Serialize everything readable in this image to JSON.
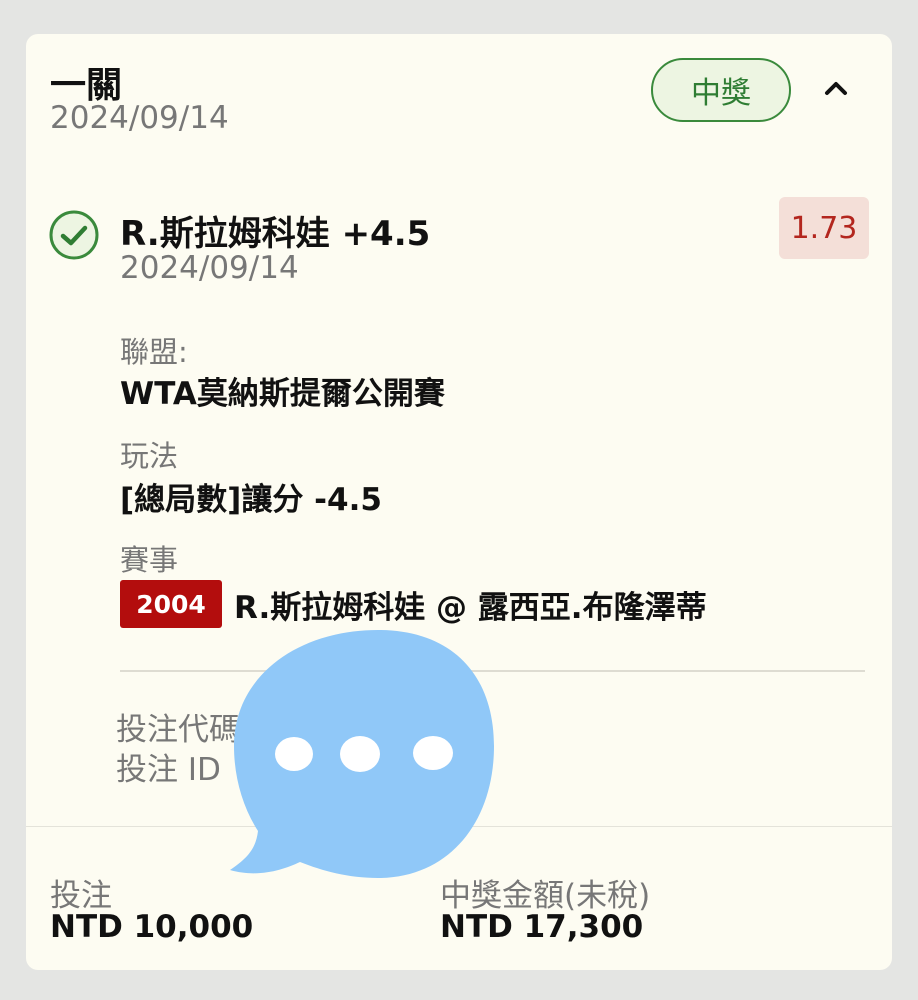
{
  "header": {
    "bet_type": "一關",
    "date": "2024/09/14",
    "status": "中獎"
  },
  "selection": {
    "name": "R.斯拉姆科娃 +4.5",
    "date": "2024/09/14",
    "odds": "1.73",
    "league_label": "聯盟:",
    "league_value": "WTA莫納斯提爾公開賽",
    "market_label": "玩法",
    "market_value": "[總局數]讓分 -4.5",
    "event_label": "賽事",
    "event_code": "2004",
    "event_name": "R.斯拉姆科娃 @ 露西亞.布隆澤蒂"
  },
  "refs": {
    "code_label": "投注代碼",
    "id_label": "投注 ID"
  },
  "footer": {
    "stake_label": "投注",
    "stake_value": "NTD 10,000",
    "payout_label": "中獎金額(未稅)",
    "payout_value": "NTD 17,300"
  },
  "colors": {
    "won": "#2f7d33",
    "odds": "#b3261e",
    "event_code_bg": "#b30d0d",
    "chat_bubble": "#90c8f8"
  },
  "icons": {
    "check": "check-circle-icon",
    "collapse": "chevron-up-icon",
    "chat": "chat-bubble-icon"
  }
}
